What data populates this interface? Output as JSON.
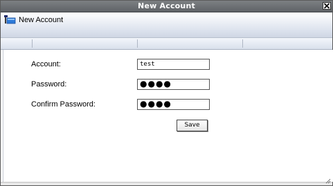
{
  "window": {
    "title": "New Account"
  },
  "header": {
    "title": "New Account",
    "icon": "account-folder-icon"
  },
  "form": {
    "account_label": "Account:",
    "account_value": "test",
    "password_label": "Password:",
    "password_value": "●●●●",
    "confirm_label": "Confirm Password:",
    "confirm_value": "●●●●",
    "save_label": "Save"
  },
  "colors": {
    "titlebar": "#6b6f73",
    "header_band": "#dde3ee",
    "accent_blue": "#1f6fd1"
  }
}
